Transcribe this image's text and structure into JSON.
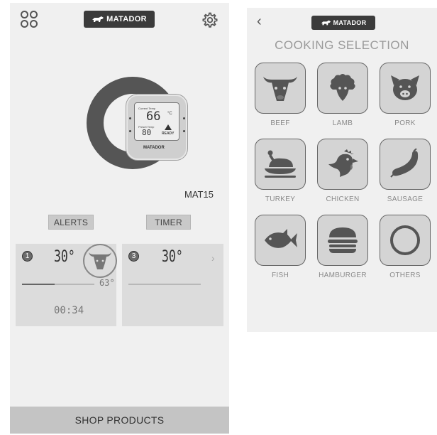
{
  "left_screen": {
    "brand": "MATADOR",
    "device_display": {
      "top_label": "Current Temp",
      "current": "66",
      "unit": "°C",
      "bottom_label": "Preset Temp",
      "preset": "80",
      "status": "READY",
      "brand": "MATADOR"
    },
    "device_name": "MAT15",
    "alerts_label": "ALERTS",
    "timer_label": "TIMER",
    "probes": [
      {
        "number": "1",
        "temp": "30°",
        "target": "63°",
        "timer": "00:34",
        "progress": 0.45,
        "meat_icon": "bull-icon"
      },
      {
        "number": "3",
        "temp": "30°",
        "chevron": "›"
      }
    ],
    "shop_label": "SHOP PRODUCTS"
  },
  "right_screen": {
    "back": "‹",
    "brand": "MATADOR",
    "title": "COOKING SELECTION",
    "options": [
      {
        "label": "BEEF",
        "icon": "bull-icon"
      },
      {
        "label": "LAMB",
        "icon": "sheep-icon"
      },
      {
        "label": "PORK",
        "icon": "pig-icon"
      },
      {
        "label": "TURKEY",
        "icon": "roast-turkey-icon"
      },
      {
        "label": "CHICKEN",
        "icon": "chicken-icon"
      },
      {
        "label": "SAUSAGE",
        "icon": "sausage-icon"
      },
      {
        "label": "FISH",
        "icon": "fish-icon"
      },
      {
        "label": "HAMBURGER",
        "icon": "hamburger-icon"
      },
      {
        "label": "OTHERS",
        "icon": "circle-icon"
      }
    ]
  }
}
